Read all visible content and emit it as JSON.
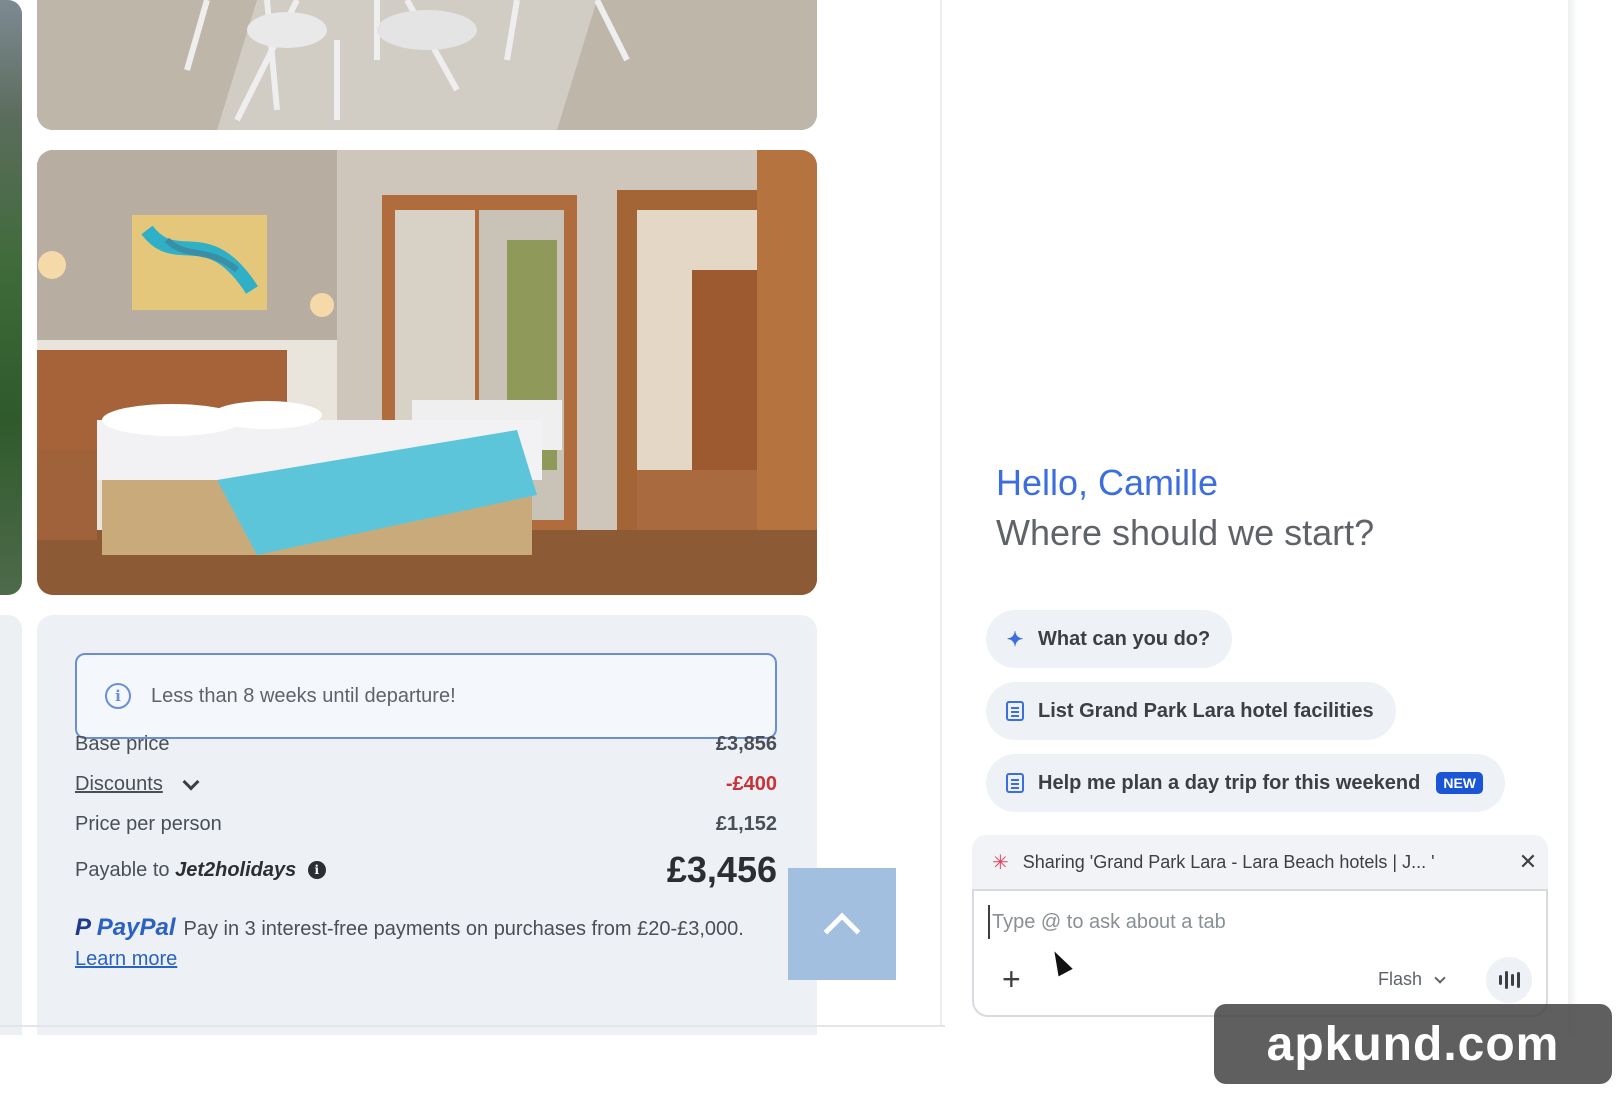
{
  "alert": {
    "text": "Less than 8 weeks until departure!"
  },
  "pricing": {
    "base_label": "Base price",
    "base_value": "£3,856",
    "discounts_label": "Discounts",
    "discounts_value": "-£400",
    "per_person_label": "Price per person",
    "per_person_value": "£1,152",
    "payable_label": "Payable to",
    "payable_brand": "Jet2holidays",
    "total": "£3,456"
  },
  "paypal": {
    "logo_p": "P",
    "logo_text": "PayPal",
    "text": "Pay in 3 interest-free payments on purchases from £20-£3,000.",
    "link": "Learn more"
  },
  "assistant": {
    "greeting": "Hello, Camille",
    "subtitle": "Where should we start?",
    "chips": [
      {
        "label": "What can you do?",
        "icon": "sparkle-icon"
      },
      {
        "label": "List Grand Park Lara hotel facilities",
        "icon": "doc-sparkle-icon"
      },
      {
        "label": "Help me plan a day trip for this weekend",
        "icon": "doc-sparkle-icon",
        "badge": "NEW"
      }
    ],
    "sharing_text": "Sharing 'Grand Park Lara - Lara Beach hotels | J... '",
    "input_placeholder": "Type @ to ask about a tab",
    "model": "Flash"
  },
  "watermark": "apkund.com",
  "colors": {
    "accent": "#3d6fdc",
    "negative": "#c8333a",
    "badge": "#1a55d6",
    "card_bg": "#edf1f5"
  }
}
